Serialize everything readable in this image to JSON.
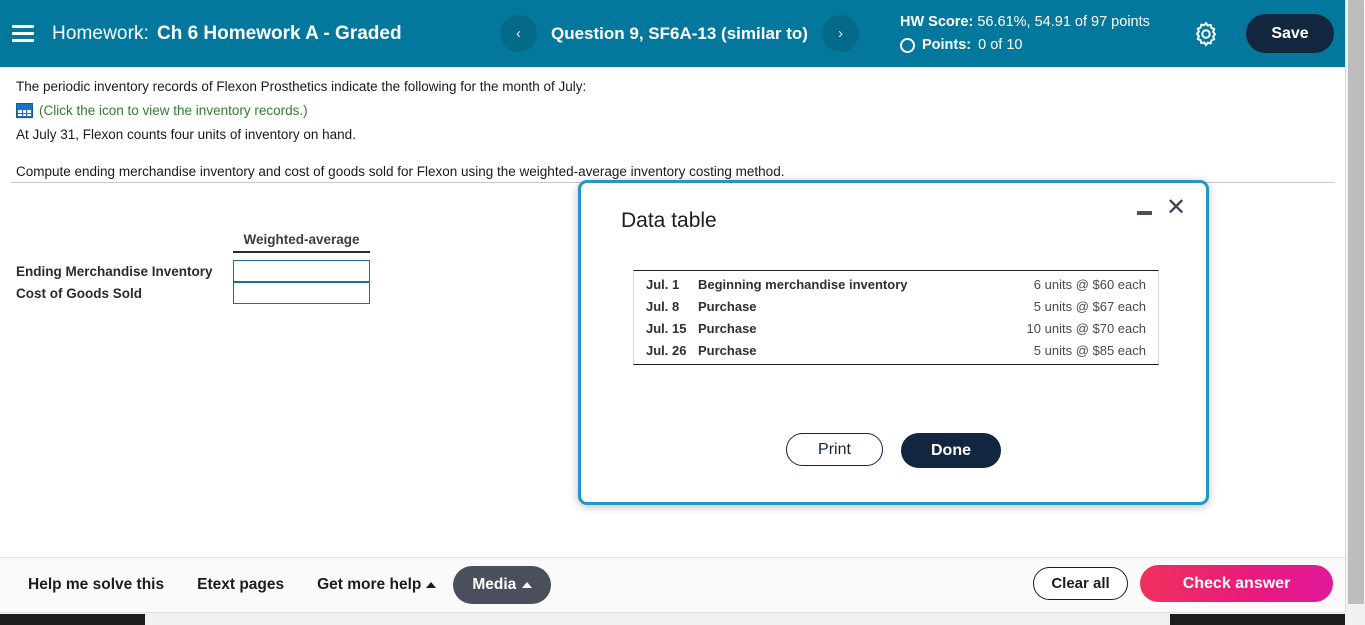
{
  "header": {
    "menu_icon": "hamburger-icon",
    "homework_label": "Homework:",
    "homework_title": "Ch 6 Homework A - Graded",
    "prev_icon": "chevron-left-icon",
    "next_icon": "chevron-right-icon",
    "question_title": "Question 9, SF6A-13 (similar to)",
    "hw_score_label": "HW Score:",
    "hw_score_value": "56.61%, 54.91 of 97 points",
    "points_label": "Points:",
    "points_value": "0 of 10",
    "settings_icon": "gear-icon",
    "save_label": "Save",
    "background_color": "#04789c",
    "save_button_color": "#12263f"
  },
  "question": {
    "line1": "The periodic inventory records of Flexon Prosthetics indicate the following for the month of July:",
    "table_icon": "grid-table-icon",
    "icon_link_text": "(Click the icon to view the inventory records.)",
    "icon_link_color": "#2e7d32",
    "line3": "At July 31, Flexon counts four units of inventory on hand.",
    "line4": "Compute ending merchandise inventory and cost of goods sold for Flexon using the weighted-average inventory costing method."
  },
  "answer_form": {
    "column_header": "Weighted-average",
    "rows": [
      {
        "label": "Ending Merchandise Inventory",
        "value": ""
      },
      {
        "label": "Cost of Goods Sold",
        "value": ""
      }
    ],
    "input_border_color": "#17728f"
  },
  "modal": {
    "title": "Data table",
    "minimize_icon": "minimize-icon",
    "close_icon": "close-icon",
    "border_color": "#2196c8",
    "rows": [
      {
        "date": "Jul. 1",
        "description": "Beginning merchandise inventory",
        "quantity": "6 units @ $60 each"
      },
      {
        "date": "Jul. 8",
        "description": "Purchase",
        "quantity": "5 units @ $67 each"
      },
      {
        "date": "Jul. 15",
        "description": "Purchase",
        "quantity": "10 units @ $70 each"
      },
      {
        "date": "Jul. 26",
        "description": "Purchase",
        "quantity": "5 units @ $85 each"
      }
    ],
    "print_label": "Print",
    "done_label": "Done"
  },
  "footer": {
    "help_me_solve": "Help me solve this",
    "etext_pages": "Etext pages",
    "get_more_help": "Get more help",
    "media": "Media",
    "caret_icon": "caret-up-icon",
    "clear_all": "Clear all",
    "check_answer": "Check answer",
    "check_answer_color": "#e8197f"
  }
}
